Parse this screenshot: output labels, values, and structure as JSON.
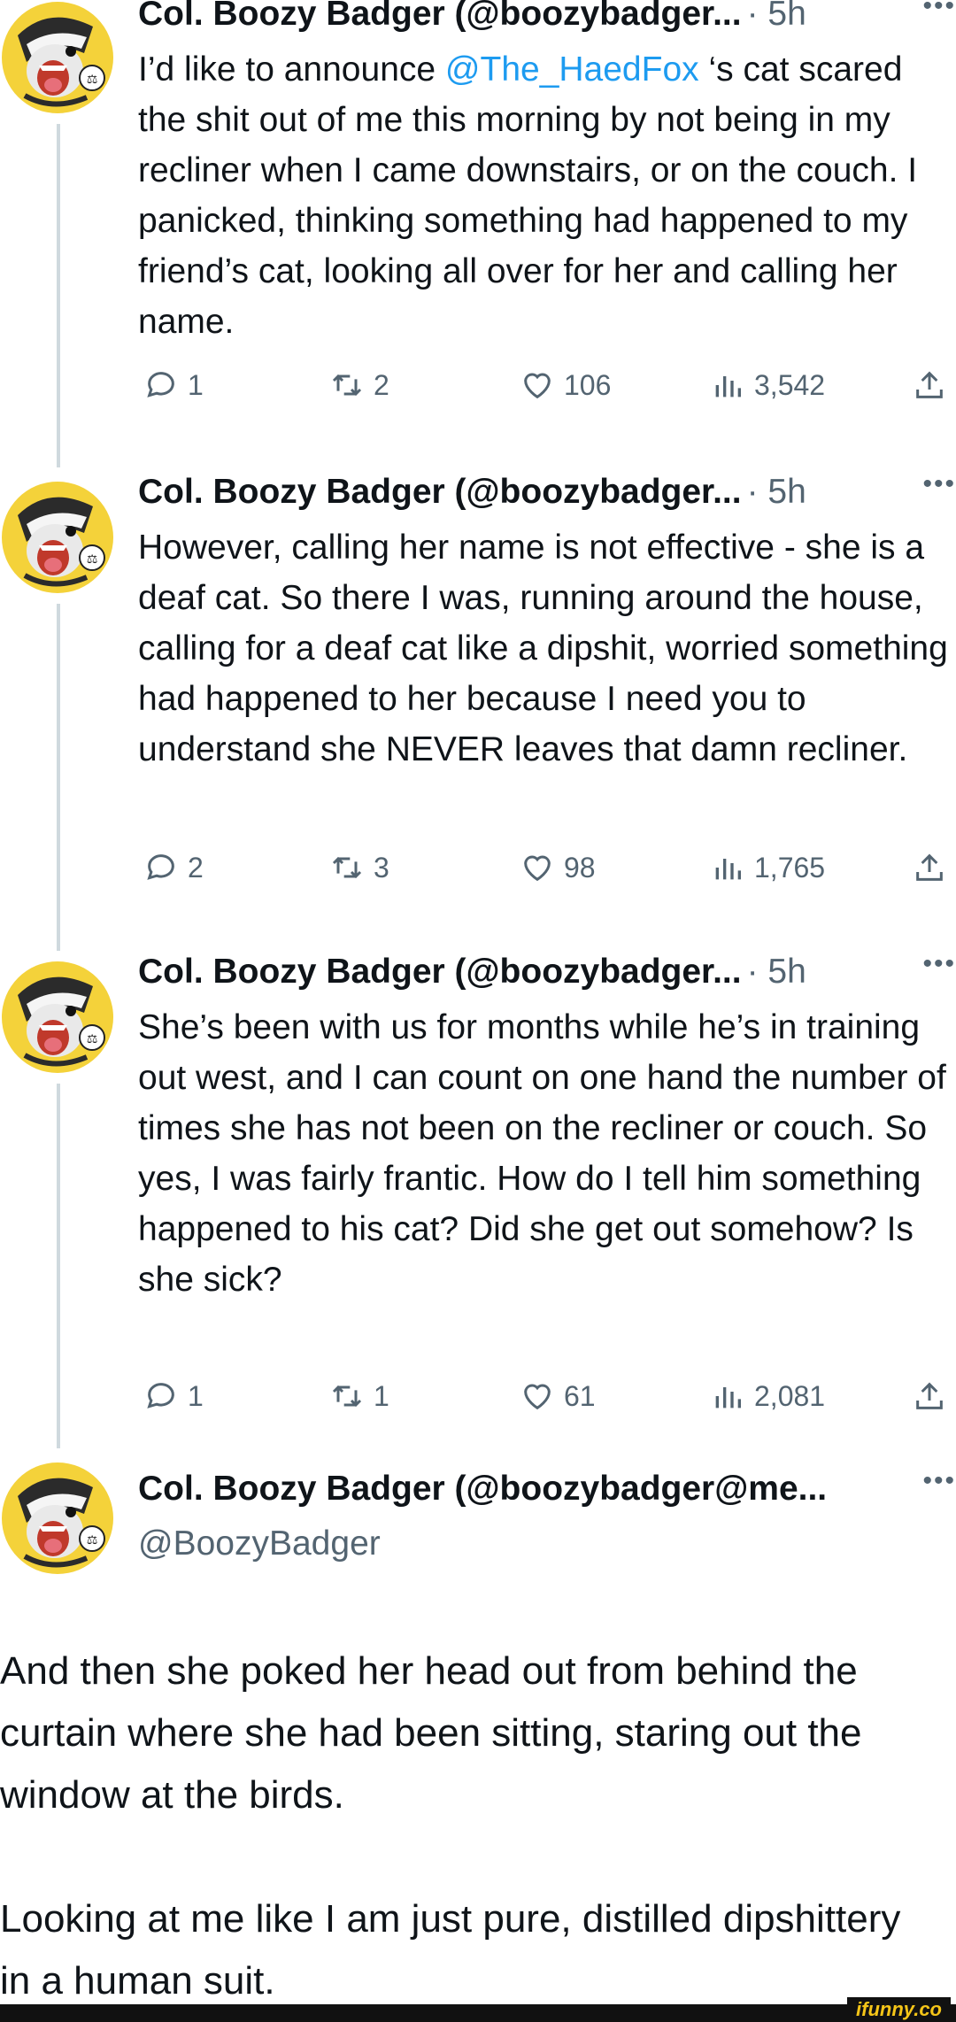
{
  "tweets": [
    {
      "name": "Col. Boozy Badger (@boozybadger...",
      "time": "· 5h",
      "more": "•••",
      "text_before": "I’d like to announce ",
      "mention": "@The_HaedFox",
      "text_after": " ‘s cat scared the shit out of me this morning by not being in my recliner when I came downstairs, or on the couch. I panicked, thinking something had happened to my friend’s cat, looking all over for her and calling her name.",
      "replies": "1",
      "retweets": "2",
      "likes": "106",
      "views": "3,542"
    },
    {
      "name": "Col. Boozy Badger (@boozybadger...",
      "time": "· 5h",
      "more": "•••",
      "text": "However, calling her name is not effective - she is a deaf cat. So there I was, running around the house, calling for a deaf cat like a dipshit, worried something had happened to her because I need you to understand she NEVER leaves that damn recliner.",
      "replies": "2",
      "retweets": "3",
      "likes": "98",
      "views": "1,765"
    },
    {
      "name": "Col. Boozy Badger (@boozybadger...",
      "time": "· 5h",
      "more": "•••",
      "text": "She’s been with us for months while he’s in training out west, and I can count on one hand the number of times she has not been on the recliner or couch. So yes, I was fairly frantic. How do I tell him something happened to his cat? Did she get out somehow? Is she sick?",
      "replies": "1",
      "retweets": "1",
      "likes": "61",
      "views": "2,081"
    }
  ],
  "main": {
    "name": "Col. Boozy Badger (@boozybadger@me...",
    "more": "•••",
    "handle": "@BoozyBadger",
    "paragraph1": "And then she poked her head out from behind the curtain where she had been sitting, staring out the window at the birds.",
    "paragraph2": "Looking at me like I am just pure, distilled dipshittery in a human suit."
  },
  "watermark": "ifunny.co",
  "colors": {
    "accent": "#1d9bf0",
    "muted": "#536471",
    "avatar_bg": "#f4d23a",
    "thread_line": "#cfd9de"
  },
  "icons": [
    "reply-icon",
    "retweet-icon",
    "like-icon",
    "views-icon",
    "share-icon"
  ]
}
